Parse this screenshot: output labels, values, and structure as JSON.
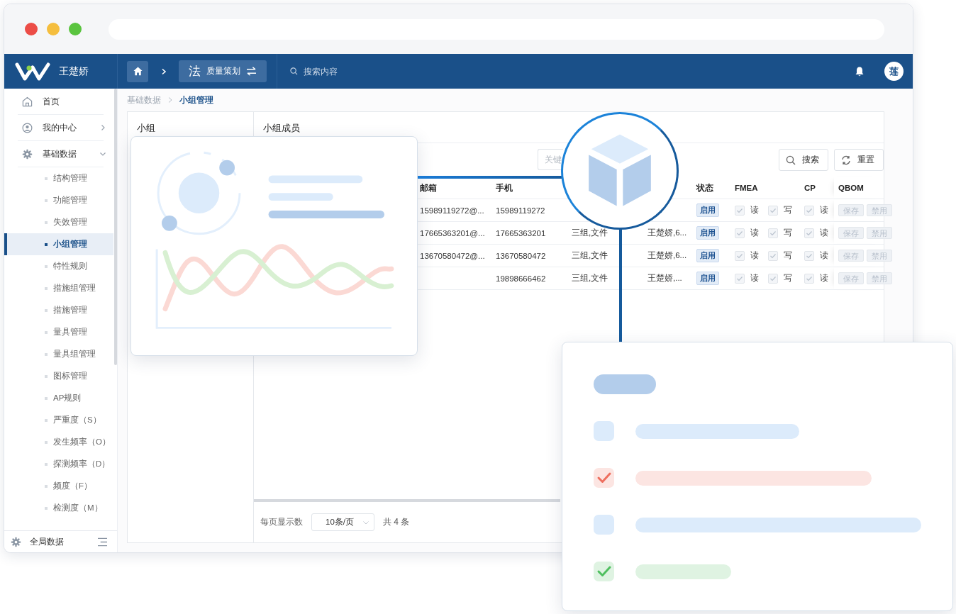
{
  "header": {
    "brand": "王楚娇",
    "module_icon": "法",
    "module": "质量策划",
    "search_placeholder": "搜索内容",
    "avatar": "莲"
  },
  "sidebar": {
    "items": [
      {
        "label": "首页"
      },
      {
        "label": "我的中心",
        "expanded": false
      },
      {
        "label": "基础数据",
        "expanded": true,
        "children": [
          {
            "label": "结构管理",
            "selected": false
          },
          {
            "label": "功能管理",
            "selected": false
          },
          {
            "label": "失效管理",
            "selected": false
          },
          {
            "label": "小组管理",
            "selected": true
          },
          {
            "label": "特性规则",
            "selected": false
          },
          {
            "label": "措施组管理",
            "selected": false
          },
          {
            "label": "措施管理",
            "selected": false
          },
          {
            "label": "量具管理",
            "selected": false
          },
          {
            "label": "量具组管理",
            "selected": false
          },
          {
            "label": "图标管理",
            "selected": false
          },
          {
            "label": "AP规则",
            "selected": false
          },
          {
            "label": "严重度（S）",
            "selected": false
          },
          {
            "label": "发生频率（O）",
            "selected": false
          },
          {
            "label": "探测频率（D）",
            "selected": false
          },
          {
            "label": "频度（F）",
            "selected": false
          },
          {
            "label": "检测度（M）",
            "selected": false
          }
        ]
      }
    ],
    "footer": "全局数据"
  },
  "breadcrumb": [
    {
      "label": "基础数据",
      "current": false
    },
    {
      "label": "小组管理",
      "current": true
    }
  ],
  "groups_panel": {
    "title": "小组"
  },
  "members_panel": {
    "title": "小组成员",
    "search": {
      "placeholder": "关键"
    },
    "buttons": [
      "搜索",
      "重置"
    ],
    "columns": [
      {
        "label": "邮箱"
      },
      {
        "label": "手机"
      },
      {
        "label": "状态"
      },
      {
        "label": "FMEA"
      },
      {
        "label": "CP"
      },
      {
        "label": "QBOM"
      }
    ],
    "rows": [
      {
        "email": "15989119272@...",
        "phone": "15989119272",
        "status": "启用",
        "fmea_read": {
          "label": "读",
          "checked": true
        },
        "fmea_write": {
          "label": "写",
          "checked": true
        },
        "cp_read": {
          "label": "读",
          "checked": true
        },
        "actions": [
          {
            "label": "保存",
            "disabled": true
          },
          {
            "label": "禁用",
            "disabled": true
          }
        ]
      },
      {
        "email": "17665363201@...",
        "phone": "17665363201",
        "group": "三组,文件",
        "members": "王楚娇,6...",
        "status": "启用",
        "fmea_read": {
          "label": "读",
          "checked": true
        },
        "fmea_write": {
          "label": "写",
          "checked": true
        },
        "cp_read": {
          "label": "读",
          "checked": true
        },
        "actions": [
          {
            "label": "保存",
            "disabled": true
          },
          {
            "label": "禁用",
            "disabled": true
          }
        ]
      },
      {
        "email": "13670580472@...",
        "phone": "13670580472",
        "group": "三组,文件",
        "members": "王楚娇,6...",
        "status": "启用",
        "fmea_read": {
          "label": "读",
          "checked": true
        },
        "fmea_write": {
          "label": "写",
          "checked": true
        },
        "cp_read": {
          "label": "读",
          "checked": true
        },
        "actions": [
          {
            "label": "保存",
            "disabled": true
          },
          {
            "label": "禁用",
            "disabled": true
          }
        ]
      },
      {
        "phone": "19898666462",
        "group": "三组,文件",
        "members": "王楚娇,...",
        "status": "启用",
        "fmea_read": {
          "label": "读",
          "checked": true
        },
        "fmea_write": {
          "label": "写",
          "checked": true
        },
        "cp_read": {
          "label": "读",
          "checked": true
        },
        "actions": [
          {
            "label": "保存",
            "disabled": true
          },
          {
            "label": "禁用",
            "disabled": true
          }
        ]
      }
    ],
    "pagination": {
      "label": "每页显示数",
      "page_size": "10条/页",
      "total": "共 4 条"
    }
  },
  "illustration": {
    "checklist": [
      {
        "checked": false,
        "color": "#dcebfb"
      },
      {
        "checked": true,
        "color": "#ee6f5f"
      },
      {
        "checked": false,
        "color": "#dcebfb"
      },
      {
        "checked": true,
        "color": "#4fbf5f"
      }
    ]
  }
}
